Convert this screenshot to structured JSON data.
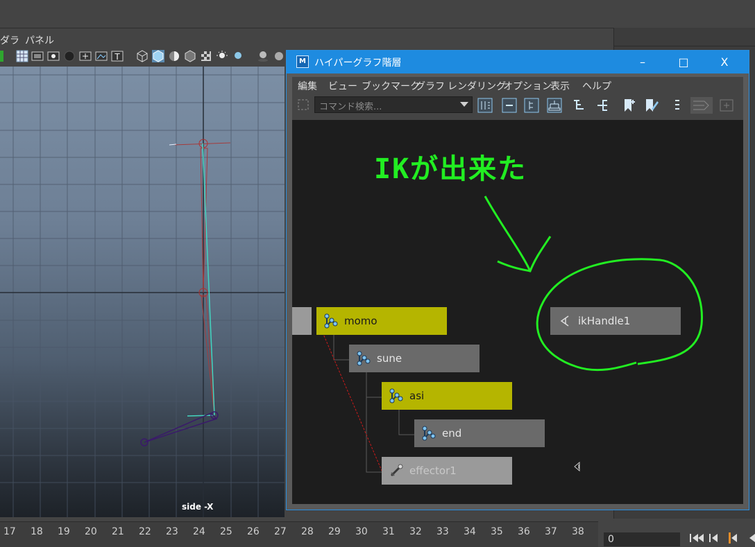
{
  "viewport": {
    "menu": [
      "ダラ",
      "パネル"
    ],
    "view_label": "side -X"
  },
  "timeline": {
    "ticks": [
      "17",
      "18",
      "19",
      "20",
      "21",
      "22",
      "23",
      "24",
      "25",
      "26",
      "27",
      "28",
      "29",
      "30",
      "31",
      "32",
      "33",
      "34",
      "35",
      "36",
      "37",
      "38"
    ],
    "current_frame": "0"
  },
  "hypergraph": {
    "title": "ハイパーグラフ階層",
    "menu": [
      "編集",
      "ビュー",
      "ブックマーク",
      "グラフ",
      "レンダリング",
      "オプション",
      "表示",
      "ヘルプ"
    ],
    "search_placeholder": "コマンド検索...",
    "window_buttons": {
      "minimize": "–",
      "maximize": "□",
      "close": "X"
    },
    "nodes": [
      {
        "label": "momo",
        "type": "joint"
      },
      {
        "label": "sune",
        "type": "joint"
      },
      {
        "label": "asi",
        "type": "joint"
      },
      {
        "label": "end",
        "type": "joint"
      },
      {
        "label": "effector1",
        "type": "effector"
      },
      {
        "label": "ikHandle1",
        "type": "ikHandle"
      }
    ],
    "annotation": "IKが出来た"
  },
  "colors": {
    "accent": "#1e8be0",
    "selected_node": "#b5b500",
    "annotation": "#22ee22"
  }
}
